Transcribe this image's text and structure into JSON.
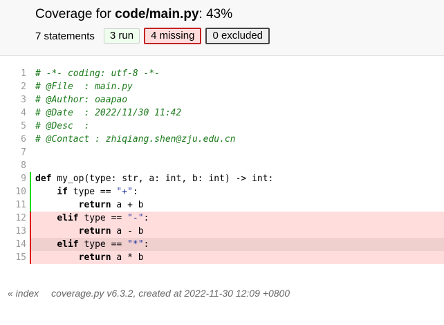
{
  "header": {
    "title_prefix": "Coverage for ",
    "file": "code/main.py",
    "title_suffix": ": 43%",
    "statements": "7 statements",
    "run_label": "3 run",
    "missing_label": "4 missing",
    "excluded_label": "0 excluded"
  },
  "lines": [
    {
      "n": "1",
      "status": "none",
      "tokens": [
        [
          "cm",
          "# -*- coding: utf-8 -*-"
        ]
      ]
    },
    {
      "n": "2",
      "status": "none",
      "tokens": [
        [
          "cm",
          "# @File  : main.py"
        ]
      ]
    },
    {
      "n": "3",
      "status": "none",
      "tokens": [
        [
          "cm",
          "# @Author: oaapao"
        ]
      ]
    },
    {
      "n": "4",
      "status": "none",
      "tokens": [
        [
          "cm",
          "# @Date  : 2022/11/30 11:42"
        ]
      ]
    },
    {
      "n": "5",
      "status": "none",
      "tokens": [
        [
          "cm",
          "# @Desc  :"
        ]
      ]
    },
    {
      "n": "6",
      "status": "none",
      "tokens": [
        [
          "cm",
          "# @Contact : zhiqiang.shen@zju.edu.cn"
        ]
      ]
    },
    {
      "n": "7",
      "status": "none",
      "tokens": []
    },
    {
      "n": "8",
      "status": "none",
      "tokens": []
    },
    {
      "n": "9",
      "status": "run",
      "tokens": [
        [
          "kw",
          "def"
        ],
        [
          "tx",
          " my_op(type: str, a: int, b: int) -> int:"
        ]
      ]
    },
    {
      "n": "10",
      "status": "run",
      "tokens": [
        [
          "tx",
          "    "
        ],
        [
          "kw",
          "if"
        ],
        [
          "tx",
          " type == "
        ],
        [
          "st",
          "\"+\""
        ],
        [
          "tx",
          ":"
        ]
      ]
    },
    {
      "n": "11",
      "status": "run",
      "tokens": [
        [
          "tx",
          "        "
        ],
        [
          "kw",
          "return"
        ],
        [
          "tx",
          " a + b"
        ]
      ]
    },
    {
      "n": "12",
      "status": "mis",
      "tokens": [
        [
          "tx",
          "    "
        ],
        [
          "kw",
          "elif"
        ],
        [
          "tx",
          " type == "
        ],
        [
          "st",
          "\"-\""
        ],
        [
          "tx",
          ":"
        ]
      ]
    },
    {
      "n": "13",
      "status": "mis",
      "tokens": [
        [
          "tx",
          "        "
        ],
        [
          "kw",
          "return"
        ],
        [
          "tx",
          " a - b"
        ]
      ]
    },
    {
      "n": "14",
      "status": "mis",
      "tokens": [
        [
          "tx",
          "    "
        ],
        [
          "kw",
          "elif"
        ],
        [
          "tx",
          " type == "
        ],
        [
          "st",
          "\"*\""
        ],
        [
          "tx",
          ":"
        ]
      ]
    },
    {
      "n": "15",
      "status": "mis",
      "tokens": [
        [
          "tx",
          "        "
        ],
        [
          "kw",
          "return"
        ],
        [
          "tx",
          " a * b"
        ]
      ]
    }
  ],
  "footer": {
    "index_link": "« index",
    "created_text": "coverage.py v6.3.2, created at 2022-11-30 12:09 +0800"
  }
}
